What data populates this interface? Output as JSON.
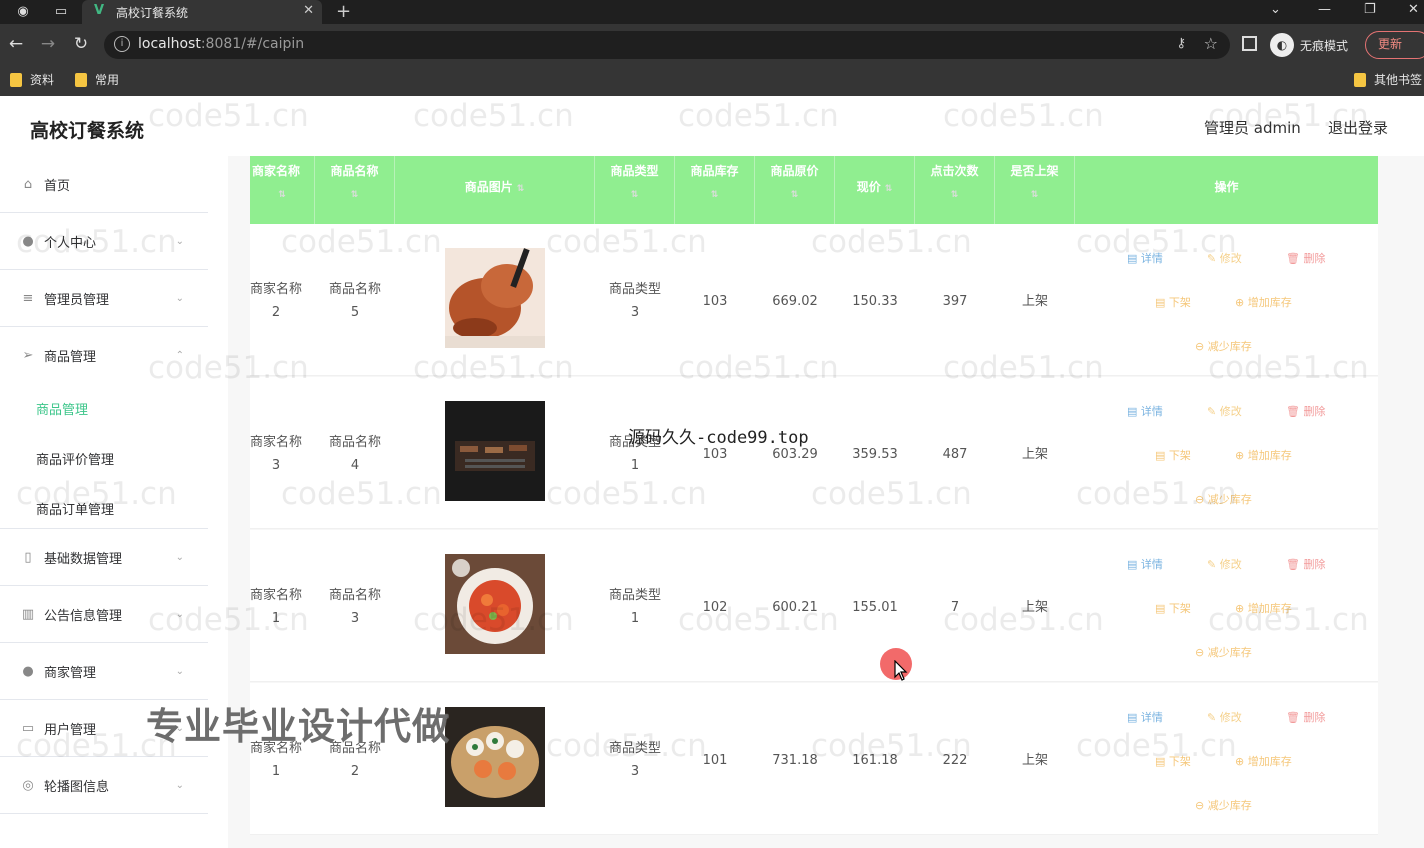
{
  "browser": {
    "tab_title": "高校订餐系统",
    "url_host": "localhost",
    "url_rest": ":8081/#/caipin",
    "incognito_label": "无痕模式",
    "update_label": "更新",
    "bookmarks": [
      "资料",
      "常用"
    ],
    "other_bookmarks": "其他书签"
  },
  "app": {
    "title": "高校订餐系统",
    "admin_label": "管理员 admin",
    "logout_label": "退出登录"
  },
  "sidebar": {
    "items": [
      {
        "label": "首页",
        "icon": "home-icon"
      },
      {
        "label": "个人中心",
        "icon": "user-icon"
      },
      {
        "label": "管理员管理",
        "icon": "list-icon"
      },
      {
        "label": "商品管理",
        "icon": "send-icon"
      },
      {
        "label": "基础数据管理",
        "icon": "phone-icon"
      },
      {
        "label": "公告信息管理",
        "icon": "bar-chart-icon"
      },
      {
        "label": "商家管理",
        "icon": "bulb-icon"
      },
      {
        "label": "用户管理",
        "icon": "card-icon"
      },
      {
        "label": "轮播图信息",
        "icon": "compass-icon"
      }
    ],
    "subitems": [
      "商品管理",
      "商品评价管理",
      "商品订单管理"
    ]
  },
  "table": {
    "headers": [
      "商家名称",
      "商品名称",
      "商品图片",
      "商品类型",
      "商品库存",
      "商品原价",
      "现价",
      "点击次数",
      "是否上架",
      "操作"
    ],
    "rows": [
      {
        "shop": "商家名称",
        "shop_no": "2",
        "name": "商品名称",
        "name_no": "5",
        "type": "商品类型",
        "type_no": "3",
        "stock": "103",
        "orig": "669.02",
        "price": "150.33",
        "clicks": "397",
        "status": "上架"
      },
      {
        "shop": "商家名称",
        "shop_no": "3",
        "name": "商品名称",
        "name_no": "4",
        "type": "商品类型",
        "type_no": "1",
        "stock": "103",
        "orig": "603.29",
        "price": "359.53",
        "clicks": "487",
        "status": "上架"
      },
      {
        "shop": "商家名称",
        "shop_no": "1",
        "name": "商品名称",
        "name_no": "3",
        "type": "商品类型",
        "type_no": "1",
        "stock": "102",
        "orig": "600.21",
        "price": "155.01",
        "clicks": "7",
        "status": "上架"
      },
      {
        "shop": "商家名称",
        "shop_no": "1",
        "name": "商品名称",
        "name_no": "2",
        "type": "商品类型",
        "type_no": "3",
        "stock": "101",
        "orig": "731.18",
        "price": "161.18",
        "clicks": "222",
        "status": "上架"
      }
    ],
    "actions": {
      "detail": "详情",
      "edit": "修改",
      "delete": "删除",
      "offshelf": "下架",
      "add_stock": "增加库存",
      "sub_stock": "减少库存"
    }
  },
  "overlays": {
    "watermark": "code51.cn",
    "center_mark": "源码久久-code99.top",
    "promo": "专业毕业设计代做"
  },
  "colors": {
    "header_green": "#90ee90",
    "active_menu": "#3cc68a"
  }
}
